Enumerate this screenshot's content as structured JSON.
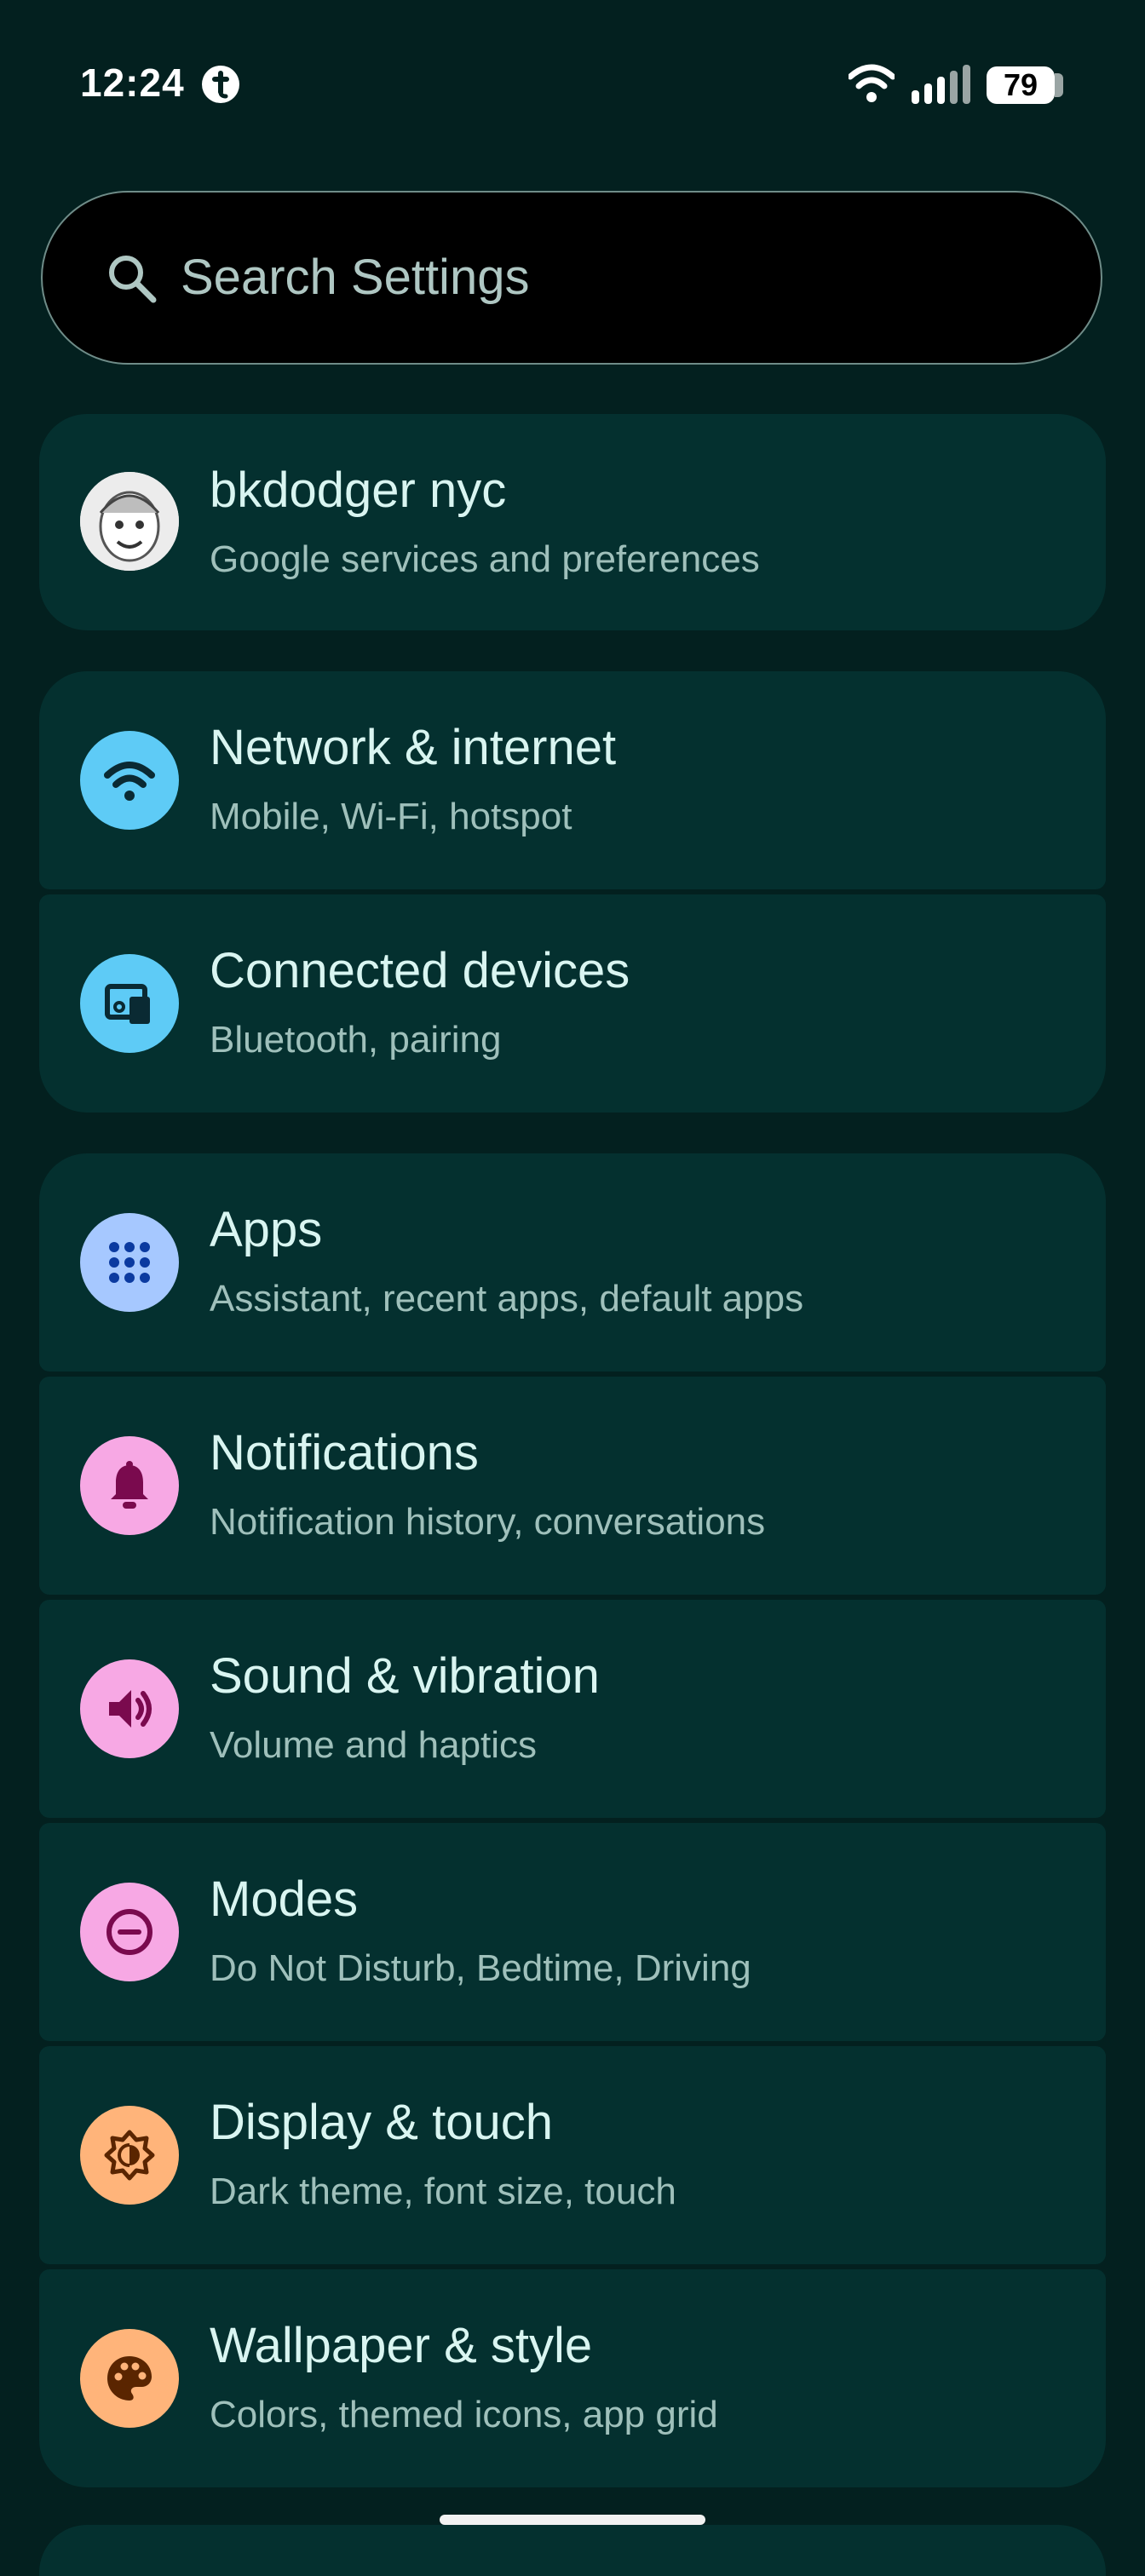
{
  "status_bar": {
    "time": "12:24",
    "notification_icon": "threads-icon",
    "battery_level": "79",
    "wifi_icon": "wifi-icon",
    "signal_icon": "cellular-signal-icon"
  },
  "search": {
    "placeholder": "Search Settings",
    "icon": "search-icon"
  },
  "account": {
    "name": "bkdodger nyc",
    "subtitle": "Google services and preferences",
    "icon": "avatar"
  },
  "items": [
    {
      "title": "Network & internet",
      "subtitle": "Mobile, Wi-Fi, hotspot",
      "icon": "wifi-icon",
      "color": "#5ECBF6"
    },
    {
      "title": "Connected devices",
      "subtitle": "Bluetooth, pairing",
      "icon": "devices-icon",
      "color": "#5ECBF6"
    },
    {
      "title": "Apps",
      "subtitle": "Assistant, recent apps, default apps",
      "icon": "apps-grid-icon",
      "color": "#A6C8FF"
    },
    {
      "title": "Notifications",
      "subtitle": "Notification history, conversations",
      "icon": "bell-icon",
      "color": "#F7A8E4"
    },
    {
      "title": "Sound & vibration",
      "subtitle": "Volume and haptics",
      "icon": "speaker-icon",
      "color": "#F7A8E4"
    },
    {
      "title": "Modes",
      "subtitle": "Do Not Disturb, Bedtime, Driving",
      "icon": "minus-circle-icon",
      "color": "#F7A8E4"
    },
    {
      "title": "Display & touch",
      "subtitle": "Dark theme, font size, touch",
      "icon": "brightness-icon",
      "color": "#FFB47A"
    },
    {
      "title": "Wallpaper & style",
      "subtitle": "Colors, themed icons, app grid",
      "icon": "palette-icon",
      "color": "#FFB47A"
    }
  ]
}
